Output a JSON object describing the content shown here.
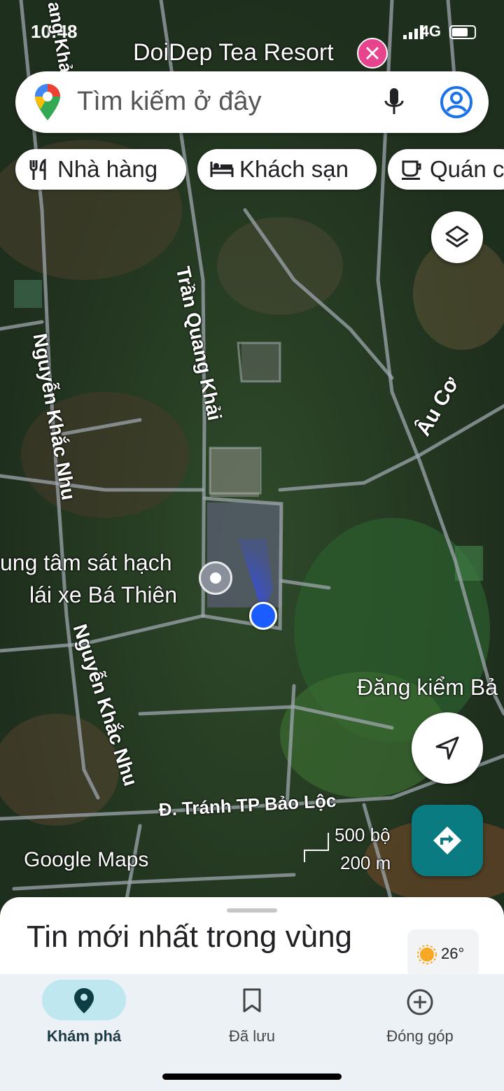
{
  "status_bar": {
    "time": "10:48",
    "network": "4G"
  },
  "map_labels": {
    "resort": "DoiDep Tea Resort",
    "road_tran_quang_khai": "Trần Quang Khải",
    "road_nguyen_khac_nhu_1": "Nguyễn Khắc Nhu",
    "road_nguyen_khac_nhu_2": "Nguyễn Khắc Nhu",
    "road_au_co": "Âu Cơ",
    "place_line1": "ung tâm sát hạch",
    "place_line2": "lái xe Bá Thiên",
    "dang_kiem": "Đăng kiểm Bả",
    "bypass": "Đ. Tránh TP Bảo Lộc",
    "road_top_left": "ang Khả",
    "watermark": "Google Maps"
  },
  "scale": {
    "imperial": "500 bộ",
    "metric": "200 m"
  },
  "search": {
    "placeholder": "Tìm kiếm ở đây"
  },
  "chips": [
    {
      "label": "Nhà hàng",
      "icon": "restaurant-icon"
    },
    {
      "label": "Khách sạn",
      "icon": "hotel-icon"
    },
    {
      "label": "Quán c",
      "icon": "coffee-icon"
    }
  ],
  "sheet": {
    "headline": "Tin mới nhất trong vùng",
    "temperature": "26°"
  },
  "nav": [
    {
      "label": "Khám phá",
      "icon": "explore-pin-icon",
      "active": true
    },
    {
      "label": "Đã lưu",
      "icon": "bookmark-icon",
      "active": false
    },
    {
      "label": "Đóng góp",
      "icon": "add-circle-icon",
      "active": false
    }
  ],
  "colors": {
    "accent_teal": "#0b7b82",
    "location_blue": "#1a5cff",
    "nav_active": "#bfe7ef"
  }
}
